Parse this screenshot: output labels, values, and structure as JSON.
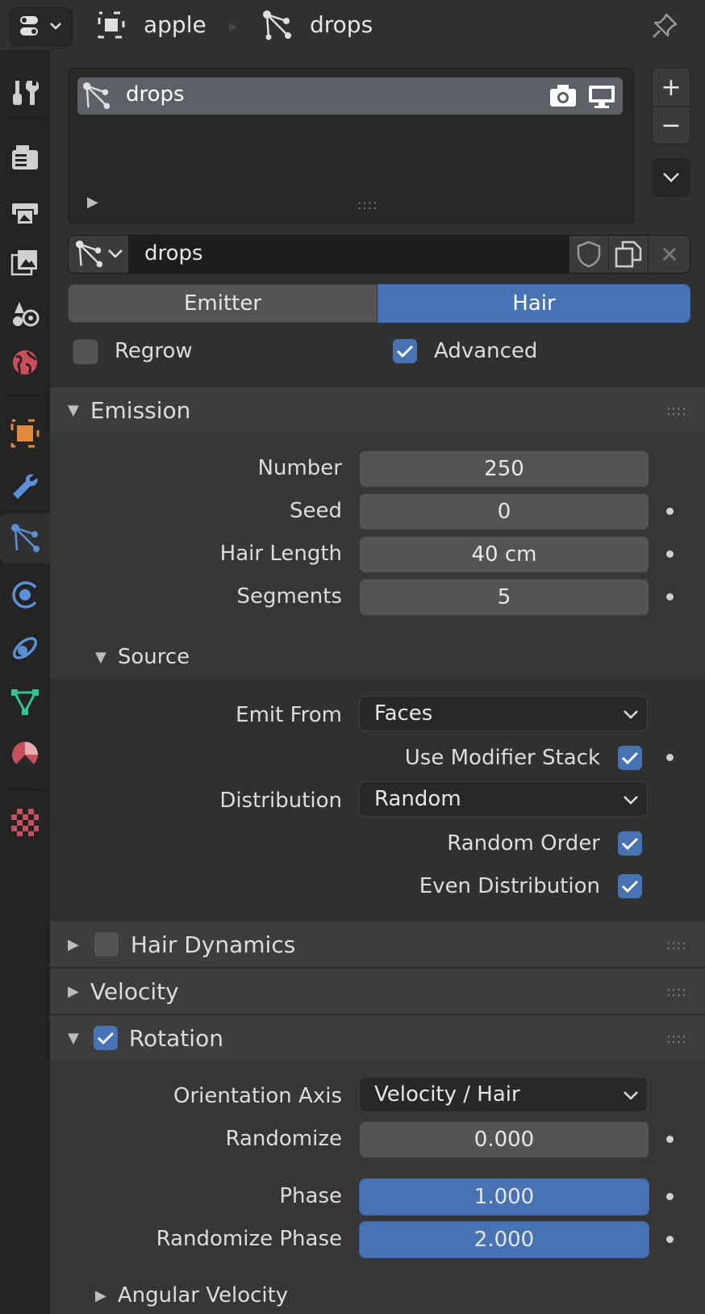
{
  "header": {
    "object_name": "apple",
    "particle_name": "drops"
  },
  "slots": {
    "item": "drops"
  },
  "datablock": {
    "name": "drops"
  },
  "type_toggle": {
    "emitter": "Emitter",
    "hair": "Hair",
    "selected": "Hair"
  },
  "options": {
    "regrow": {
      "label": "Regrow",
      "checked": false
    },
    "advanced": {
      "label": "Advanced",
      "checked": true
    }
  },
  "emission": {
    "title": "Emission",
    "number_label": "Number",
    "number": "250",
    "seed_label": "Seed",
    "seed": "0",
    "hair_length_label": "Hair Length",
    "hair_length": "40 cm",
    "segments_label": "Segments",
    "segments": "5"
  },
  "source": {
    "title": "Source",
    "emit_from_label": "Emit From",
    "emit_from": "Faces",
    "use_modifier_stack": "Use Modifier Stack",
    "distribution_label": "Distribution",
    "distribution": "Random",
    "random_order": "Random Order",
    "even_distribution": "Even Distribution"
  },
  "hair_dynamics": {
    "title": "Hair Dynamics",
    "checked": false
  },
  "velocity": {
    "title": "Velocity"
  },
  "rotation": {
    "title": "Rotation",
    "checked": true,
    "orientation_axis_label": "Orientation Axis",
    "orientation_axis": "Velocity / Hair",
    "randomize_label": "Randomize",
    "randomize": "0.000",
    "phase_label": "Phase",
    "phase": "1.000",
    "randomize_phase_label": "Randomize Phase",
    "randomize_phase": "2.000"
  },
  "angular_velocity": {
    "title": "Angular Velocity"
  },
  "colors": {
    "accent": "#4772b3",
    "background": "#303030",
    "panel_header": "#3d3d3d"
  }
}
